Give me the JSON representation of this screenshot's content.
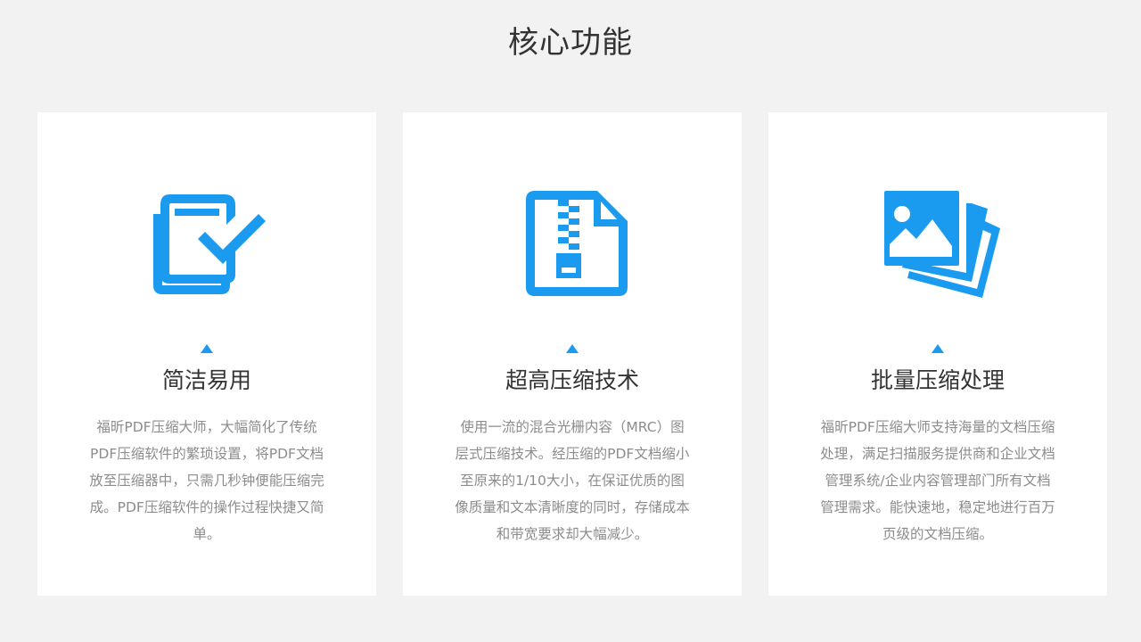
{
  "section": {
    "title": "核心功能"
  },
  "colors": {
    "accent": "#1b9bf0",
    "background": "#f2f2f2",
    "card": "#ffffff",
    "title_text": "#333333",
    "desc_text": "#8c8c8c"
  },
  "features": [
    {
      "icon": "document-check-icon",
      "title": "简洁易用",
      "description": "福昕PDF压缩大师，大幅简化了传统PDF压缩软件的繁琐设置，将PDF文档放至压缩器中，只需几秒钟便能压缩完成。PDF压缩软件的操作过程快捷又简单。"
    },
    {
      "icon": "zip-file-icon",
      "title": "超高压缩技术",
      "description": "使用一流的混合光栅内容（MRC）图层式压缩技术。经压缩的PDF文档缩小至原来的1/10大小，在保证优质的图像质量和文本清晰度的同时，存储成本和带宽要求却大幅减少。"
    },
    {
      "icon": "image-stack-icon",
      "title": "批量压缩处理",
      "description": "福昕PDF压缩大师支持海量的文档压缩处理，满足扫描服务提供商和企业文档管理系统/企业内容管理部门所有文档管理需求。能快速地，稳定地进行百万页级的文档压缩。"
    }
  ]
}
